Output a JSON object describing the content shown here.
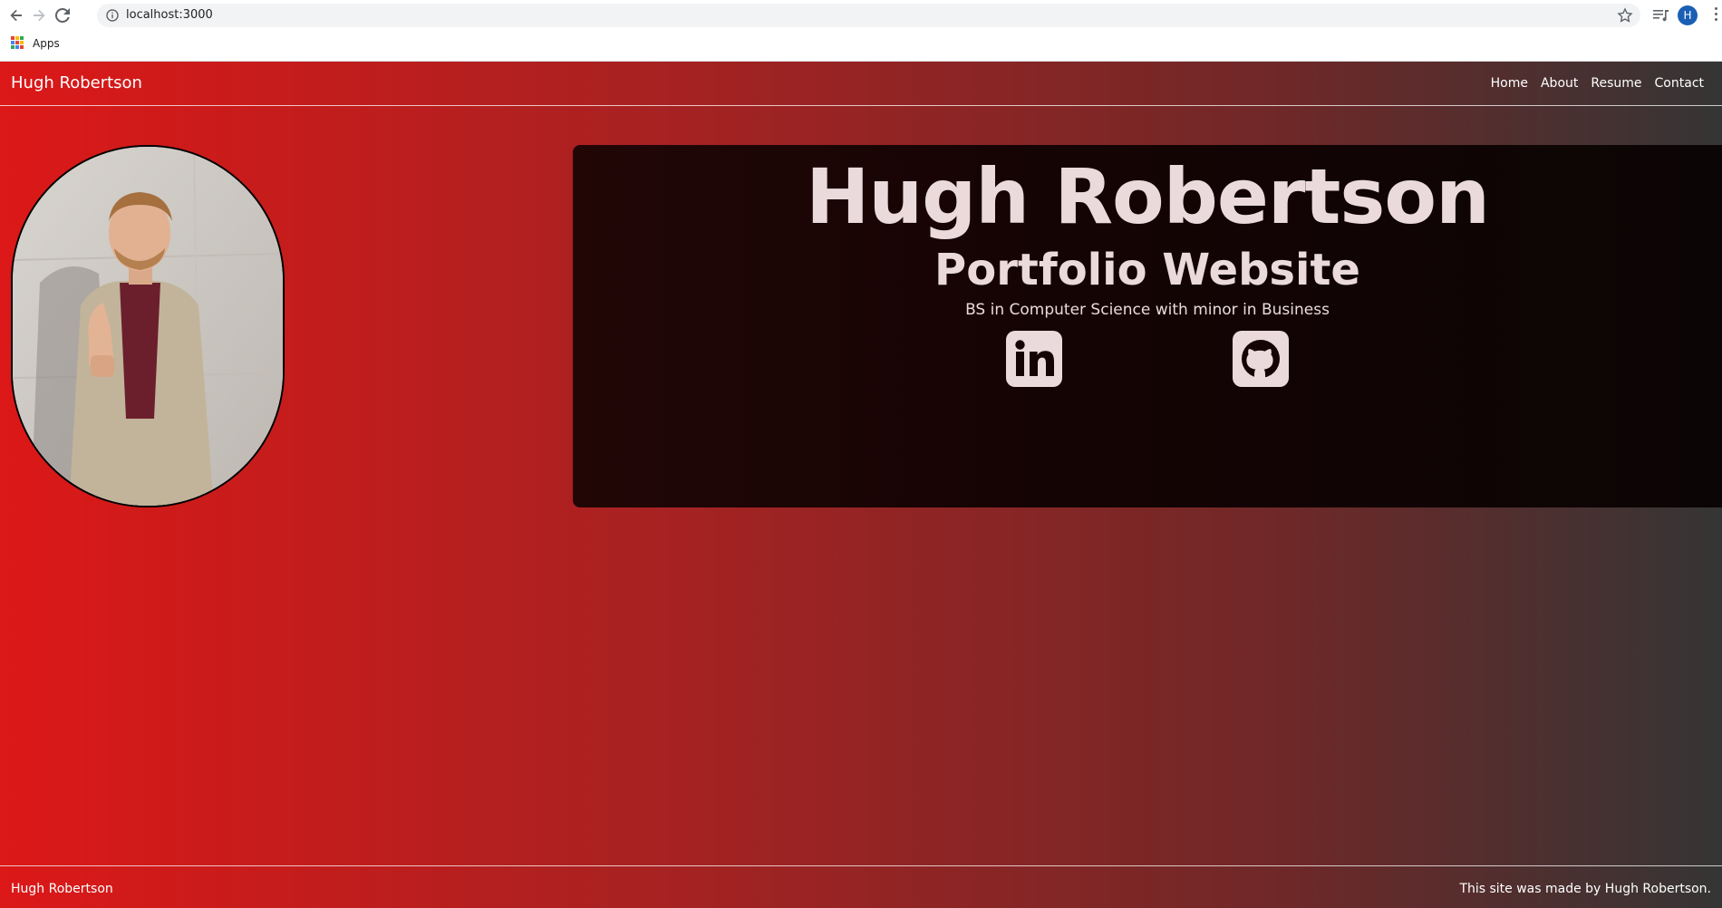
{
  "browser": {
    "url": "localhost:3000",
    "profile_initial": "H",
    "bookmarks_apps_label": "Apps",
    "icons": [
      "back-arrow-icon",
      "forward-arrow-icon",
      "reload-icon",
      "site-info-icon",
      "bookmark-star-icon",
      "media-control-icon",
      "kebab-menu-icon",
      "apps-grid-icon"
    ]
  },
  "site": {
    "brand": "Hugh Robertson",
    "nav": [
      "Home",
      "About",
      "Resume",
      "Contact"
    ],
    "hero": {
      "title": "Hugh Robertson",
      "subtitle": "Portfolio Website",
      "degree": "BS in Computer Science with minor in Business",
      "social_icons": [
        "linkedin-icon",
        "github-icon"
      ]
    },
    "footer": {
      "left": "Hugh Robertson",
      "right": "This site was made by Hugh Robertson."
    }
  },
  "colors": {
    "gradient_start": "#dc1818",
    "gradient_end": "#353535",
    "hero_bg": "#150404",
    "hero_text": "#eadadc"
  }
}
